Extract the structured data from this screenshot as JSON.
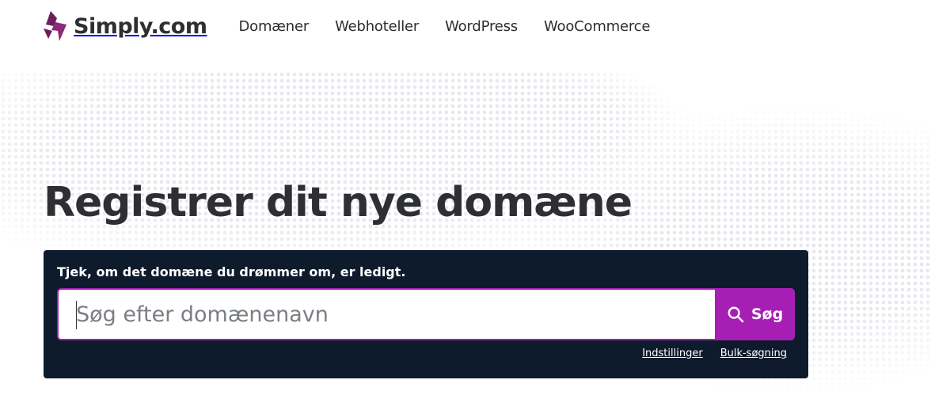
{
  "brand": {
    "name": "Simply.com",
    "logo_icon": "lightning-bolt-logo",
    "accent_color": "#a61eb4",
    "logo_color": "#6b1f5e"
  },
  "nav": {
    "items": [
      {
        "label": "Domæner"
      },
      {
        "label": "Webhoteller"
      },
      {
        "label": "WordPress"
      },
      {
        "label": "WooCommerce"
      }
    ]
  },
  "hero": {
    "title": "Registrer dit nye domæne"
  },
  "search": {
    "label": "Tjek, om det domæne du drømmer om, er ledigt.",
    "placeholder": "Søg efter domænenavn",
    "value": "",
    "button_label": "Søg",
    "button_icon": "search-icon",
    "panel_color": "#0e1b2c",
    "links": [
      {
        "label": "Indstillinger"
      },
      {
        "label": "Bulk-søgning"
      }
    ]
  }
}
